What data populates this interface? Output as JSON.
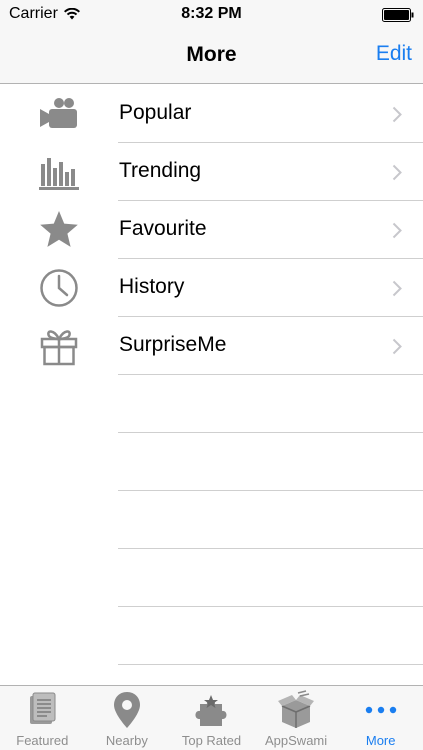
{
  "status_bar": {
    "carrier": "Carrier",
    "time": "8:32 PM"
  },
  "nav": {
    "title": "More",
    "edit_label": "Edit"
  },
  "list": {
    "items": [
      {
        "label": "Popular",
        "icon": "video-camera-icon"
      },
      {
        "label": "Trending",
        "icon": "bar-chart-icon"
      },
      {
        "label": "Favourite",
        "icon": "star-icon"
      },
      {
        "label": "History",
        "icon": "clock-icon"
      },
      {
        "label": "SurpriseMe",
        "icon": "gift-icon"
      }
    ]
  },
  "tab_bar": {
    "tabs": [
      {
        "label": "Featured",
        "icon": "document-icon",
        "active": false
      },
      {
        "label": "Nearby",
        "icon": "location-pin-icon",
        "active": false
      },
      {
        "label": "Top Rated",
        "icon": "puzzle-badge-icon",
        "active": false
      },
      {
        "label": "AppSwami",
        "icon": "box-icon",
        "active": false
      },
      {
        "label": "More",
        "icon": "more-dots-icon",
        "active": true
      }
    ]
  },
  "colors": {
    "accent": "#1a7ef0",
    "icon_gray": "#8a8a8a",
    "separator": "#cfcfcf",
    "bar_background": "#f7f7f7"
  }
}
